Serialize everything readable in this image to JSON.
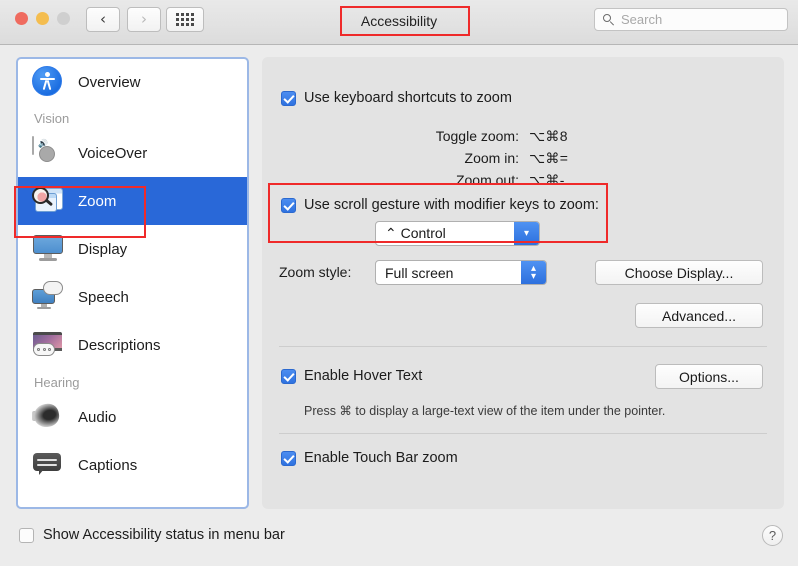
{
  "titlebar": {
    "title": "Accessibility",
    "back_icon": "chevron-left-icon",
    "forward_icon": "chevron-right-icon",
    "grid_icon": "grid-dots-icon",
    "search": {
      "placeholder": "Search",
      "value": "",
      "icon": "search-icon"
    },
    "lights": [
      "close-button",
      "minimize-button",
      "zoom-button"
    ]
  },
  "sidebar": {
    "items": [
      {
        "label": "Overview",
        "icon": "accessibility-person-icon",
        "selected": false,
        "type": "item"
      },
      {
        "label": "Vision",
        "type": "group"
      },
      {
        "label": "VoiceOver",
        "icon": "voiceover-icon",
        "selected": false,
        "type": "item"
      },
      {
        "label": "Zoom",
        "icon": "zoom-magnifier-icon",
        "selected": true,
        "type": "item"
      },
      {
        "label": "Display",
        "icon": "display-monitor-icon",
        "selected": false,
        "type": "item"
      },
      {
        "label": "Speech",
        "icon": "speech-bubble-monitor-icon",
        "selected": false,
        "type": "item"
      },
      {
        "label": "Descriptions",
        "icon": "descriptions-icon",
        "selected": false,
        "type": "item"
      },
      {
        "label": "Hearing",
        "type": "group"
      },
      {
        "label": "Audio",
        "icon": "speaker-icon",
        "selected": false,
        "type": "item"
      },
      {
        "label": "Captions",
        "icon": "captions-icon",
        "selected": false,
        "type": "item"
      }
    ]
  },
  "main": {
    "keyboard_shortcuts": {
      "label": "Use keyboard shortcuts to zoom",
      "checked": true,
      "rows": [
        {
          "key": "Toggle zoom:",
          "value": "⌥⌘8"
        },
        {
          "key": "Zoom in:",
          "value": "⌥⌘="
        },
        {
          "key": "Zoom out:",
          "value": "⌥⌘-"
        }
      ]
    },
    "scroll_gesture": {
      "label": "Use scroll gesture with modifier keys to zoom:",
      "checked": true,
      "modifier_value": "⌃ Control",
      "modifier_icon": "chevron-down-icon"
    },
    "zoom_style": {
      "label": "Zoom style:",
      "value": "Full screen",
      "stepper_icon": "chevron-up-down-icon"
    },
    "choose_display_button": "Choose Display...",
    "advanced_button": "Advanced...",
    "hover_text": {
      "label": "Enable Hover Text",
      "checked": true,
      "options_button": "Options...",
      "hint": "Press ⌘ to display a large-text view of the item under the pointer."
    },
    "touch_bar": {
      "label": "Enable Touch Bar zoom",
      "checked": true
    }
  },
  "footer": {
    "status_checkbox": {
      "label": "Show Accessibility status in menu bar",
      "checked": false
    },
    "help_button": "?"
  },
  "annotations": [
    {
      "name": "title-highlight",
      "color": "#ef2a2a"
    },
    {
      "name": "sidebar-zoom-highlight",
      "color": "#ef2a2a"
    },
    {
      "name": "scroll-gesture-highlight",
      "color": "#ef2a2a"
    }
  ]
}
